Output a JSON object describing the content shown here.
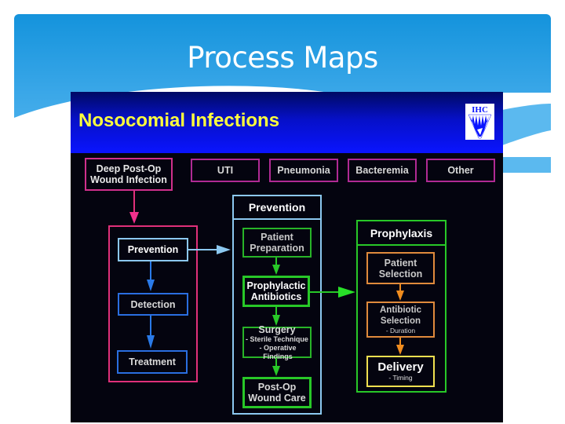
{
  "slide": {
    "title": "Process Maps"
  },
  "panel": {
    "title": "Nosocomial Infections",
    "logo_text": "IHC",
    "logo_icon": "ihc-logo-icon",
    "colors": {
      "title": "#ffff3c",
      "category_border": "#b02a94",
      "infection_group_border": "#e0307a",
      "prevention_border": "#8cc8f0",
      "stage_border": "#2a6ee0",
      "green_border": "#28c828",
      "orange_border": "#e08a3c",
      "delivery_border": "#f0e050"
    }
  },
  "categories": [
    {
      "label": "Deep Post-Op Wound Infection",
      "lines": [
        "Deep Post-Op",
        "Wound Infection"
      ],
      "selected": true
    },
    {
      "label": "UTI",
      "lines": [
        "UTI"
      ],
      "selected": false
    },
    {
      "label": "Pneumonia",
      "lines": [
        "Pneumonia"
      ],
      "selected": false
    },
    {
      "label": "Bacteremia",
      "lines": [
        "Bacteremia"
      ],
      "selected": false
    },
    {
      "label": "Other",
      "lines": [
        "Other"
      ],
      "selected": false
    }
  ],
  "stages": [
    {
      "label": "Prevention",
      "highlighted": true
    },
    {
      "label": "Detection",
      "highlighted": false
    },
    {
      "label": "Treatment",
      "highlighted": false
    }
  ],
  "prevention": {
    "title": "Prevention",
    "steps": [
      {
        "lines": [
          "Patient",
          "Preparation"
        ],
        "notes": []
      },
      {
        "lines": [
          "Prophylactic",
          "Antibiotics"
        ],
        "notes": [],
        "highlighted": true
      },
      {
        "lines": [
          "Surgery"
        ],
        "notes": [
          "- Sterile Technique",
          "- Operative Findings"
        ]
      },
      {
        "lines": [
          "Post-Op",
          "Wound Care"
        ],
        "notes": []
      }
    ]
  },
  "prophylaxis": {
    "title": "Prophylaxis",
    "steps": [
      {
        "lines": [
          "Patient",
          "Selection"
        ],
        "notes": []
      },
      {
        "lines": [
          "Antibiotic",
          "Selection"
        ],
        "notes": [
          "- Duration"
        ]
      },
      {
        "lines": [
          "Delivery"
        ],
        "notes": [
          "- Timing"
        ],
        "highlighted": true
      }
    ]
  }
}
